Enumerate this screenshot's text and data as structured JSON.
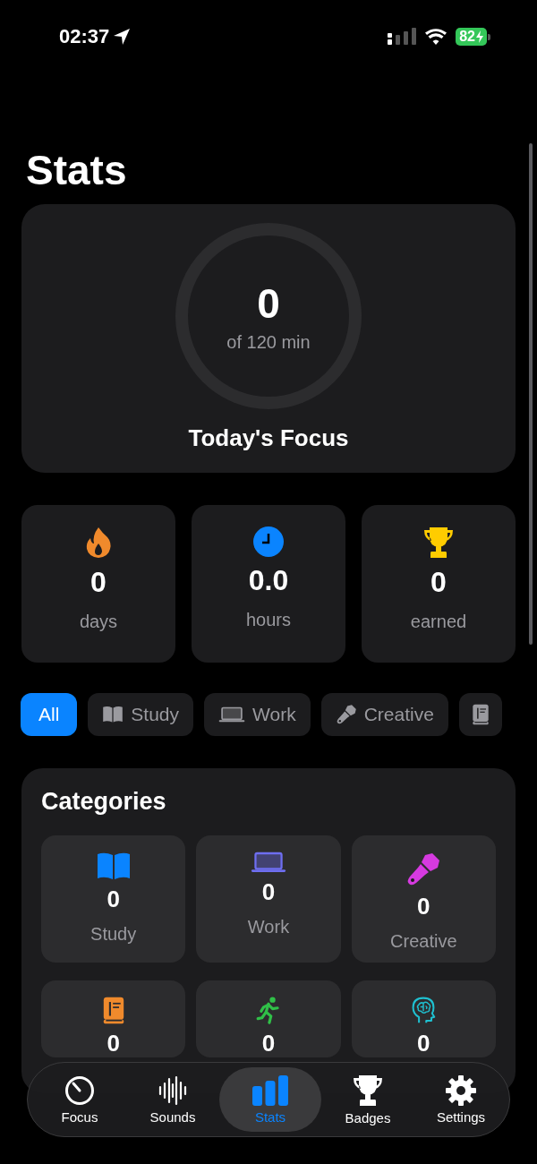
{
  "status_bar": {
    "time": "02:37",
    "battery": "82"
  },
  "title": "Stats",
  "focus_card": {
    "value": "0",
    "caption": "of 120 min",
    "label": "Today's Focus"
  },
  "stat_cards": [
    {
      "value": "0",
      "label": "days"
    },
    {
      "value": "0.0",
      "label": "hours"
    },
    {
      "value": "0",
      "label": "earned"
    }
  ],
  "filter_chips": [
    {
      "label": "All",
      "selected": true
    },
    {
      "label": "Study",
      "selected": false
    },
    {
      "label": "Work",
      "selected": false
    },
    {
      "label": "Creative",
      "selected": false
    },
    {
      "selected": false
    }
  ],
  "categories": {
    "title": "Categories",
    "items": [
      {
        "value": "0",
        "label": "Study",
        "color": "#0a84ff"
      },
      {
        "value": "0",
        "label": "Work",
        "color": "#6e6ef0"
      },
      {
        "value": "0",
        "label": "Creative",
        "color": "#d63ae0"
      },
      {
        "value": "0",
        "color": "#f08a2c"
      },
      {
        "value": "0",
        "color": "#30c048"
      },
      {
        "value": "0",
        "color": "#1fc0d0"
      }
    ]
  },
  "tab_bar": [
    {
      "label": "Focus",
      "selected": false
    },
    {
      "label": "Sounds",
      "selected": false
    },
    {
      "label": "Stats",
      "selected": true
    },
    {
      "label": "Badges",
      "selected": false
    },
    {
      "label": "Settings",
      "selected": false
    }
  ]
}
